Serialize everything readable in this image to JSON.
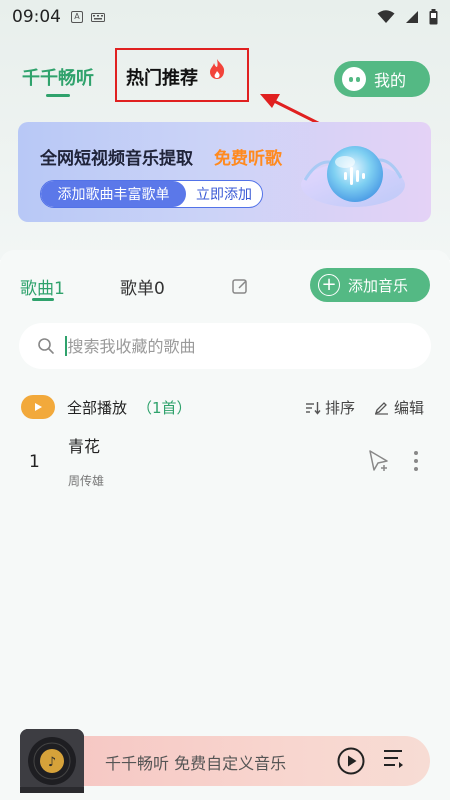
{
  "status_bar": {
    "time": "09:04",
    "icons": [
      "font-icon",
      "keyboard-icon",
      "wifi-icon",
      "signal-icon",
      "battery-icon"
    ]
  },
  "nav": {
    "tab_main": "千千畅听",
    "tab_hot": "热门推荐",
    "mine_label": "我的",
    "accent": "#2fa26c",
    "annotation_color": "#e02020"
  },
  "banner": {
    "title": "全网短视频音乐提取",
    "free_label": "免费听歌",
    "pill_left": "添加歌曲丰富歌单",
    "pill_right": "立即添加"
  },
  "library": {
    "tab_songs": "歌曲1",
    "tab_playlists": "歌单0",
    "add_music": "添加音乐",
    "search_placeholder": "搜索我收藏的歌曲",
    "play_all": "全部播放",
    "play_all_count": "（1首）",
    "sort": "排序",
    "edit": "编辑",
    "songs": [
      {
        "index": "1",
        "title": "青花",
        "artist": "周传雄"
      }
    ]
  },
  "player": {
    "text": "千千畅听 免费自定义音乐"
  }
}
